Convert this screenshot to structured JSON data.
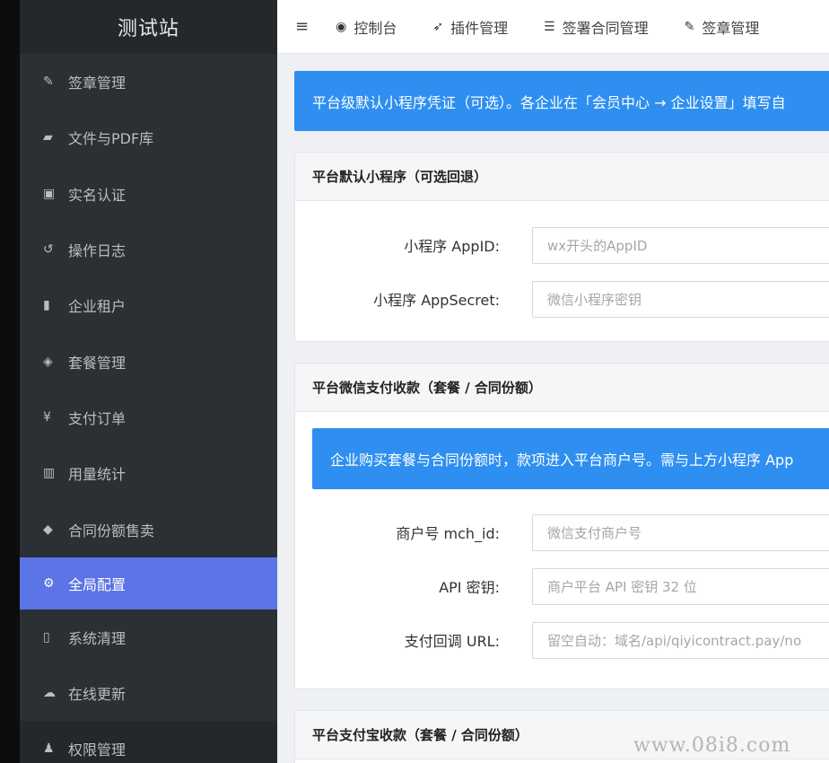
{
  "brand": "测试站",
  "sidebar": {
    "items": [
      {
        "label": "签章管理",
        "icon": "edit-icon",
        "glyph": "✎"
      },
      {
        "label": "文件与PDF库",
        "icon": "folder-icon",
        "glyph": "▰"
      },
      {
        "label": "实名认证",
        "icon": "id-card-icon",
        "glyph": "▣"
      },
      {
        "label": "操作日志",
        "icon": "history-icon",
        "glyph": "↺"
      },
      {
        "label": "企业租户",
        "icon": "building-icon",
        "glyph": "▮"
      },
      {
        "label": "套餐管理",
        "icon": "cube-icon",
        "glyph": "◈"
      },
      {
        "label": "支付订单",
        "icon": "yen-icon",
        "glyph": "¥"
      },
      {
        "label": "用量统计",
        "icon": "bar-chart-icon",
        "glyph": "▥"
      },
      {
        "label": "合同份额售卖",
        "icon": "tag-icon",
        "glyph": "◆"
      },
      {
        "label": "全局配置",
        "icon": "cogs-icon",
        "glyph": "⚙"
      },
      {
        "label": "系统清理",
        "icon": "trash-icon",
        "glyph": "▯"
      },
      {
        "label": "在线更新",
        "icon": "cloud-upload-icon",
        "glyph": "☁"
      },
      {
        "label": "权限管理",
        "icon": "users-icon",
        "glyph": "♟"
      }
    ],
    "active_index": 9
  },
  "topbar": {
    "menu_icon": "hamburger-icon",
    "nav": [
      {
        "label": "控制台",
        "icon": "dashboard-icon",
        "glyph": "◉"
      },
      {
        "label": "插件管理",
        "icon": "rocket-icon",
        "glyph": "➶"
      },
      {
        "label": "签署合同管理",
        "icon": "list-icon",
        "glyph": "☰"
      },
      {
        "label": "签章管理",
        "icon": "edit-icon",
        "glyph": "✎"
      }
    ]
  },
  "notice": "平台级默认小程序凭证（可选）。各企业在「会员中心 → 企业设置」填写自",
  "panels": {
    "miniapp": {
      "title": "平台默认小程序（可选回退）",
      "fields": [
        {
          "label": "小程序 AppID:",
          "placeholder": "wx开头的AppID"
        },
        {
          "label": "小程序 AppSecret:",
          "placeholder": "微信小程序密钥"
        }
      ]
    },
    "wechat_pay": {
      "title": "平台微信支付收款（套餐 / 合同份额）",
      "notice": "企业购买套餐与合同份额时，款项进入平台商户号。需与上方小程序 App",
      "fields": [
        {
          "label": "商户号 mch_id:",
          "placeholder": "微信支付商户号"
        },
        {
          "label": "API 密钥:",
          "placeholder": "商户平台 API 密钥 32 位"
        },
        {
          "label": "支付回调 URL:",
          "placeholder": "留空自动：域名/api/qiyicontract.pay/no"
        }
      ]
    },
    "alipay": {
      "title": "平台支付宝收款（套餐 / 合同份额）"
    }
  },
  "watermark": "www.08i8.com",
  "colors": {
    "sidebar_bg": "#2b3034",
    "active_item": "#5b74e6",
    "notice_blue": "#2e8ff0",
    "content_bg": "#eef0f3"
  }
}
